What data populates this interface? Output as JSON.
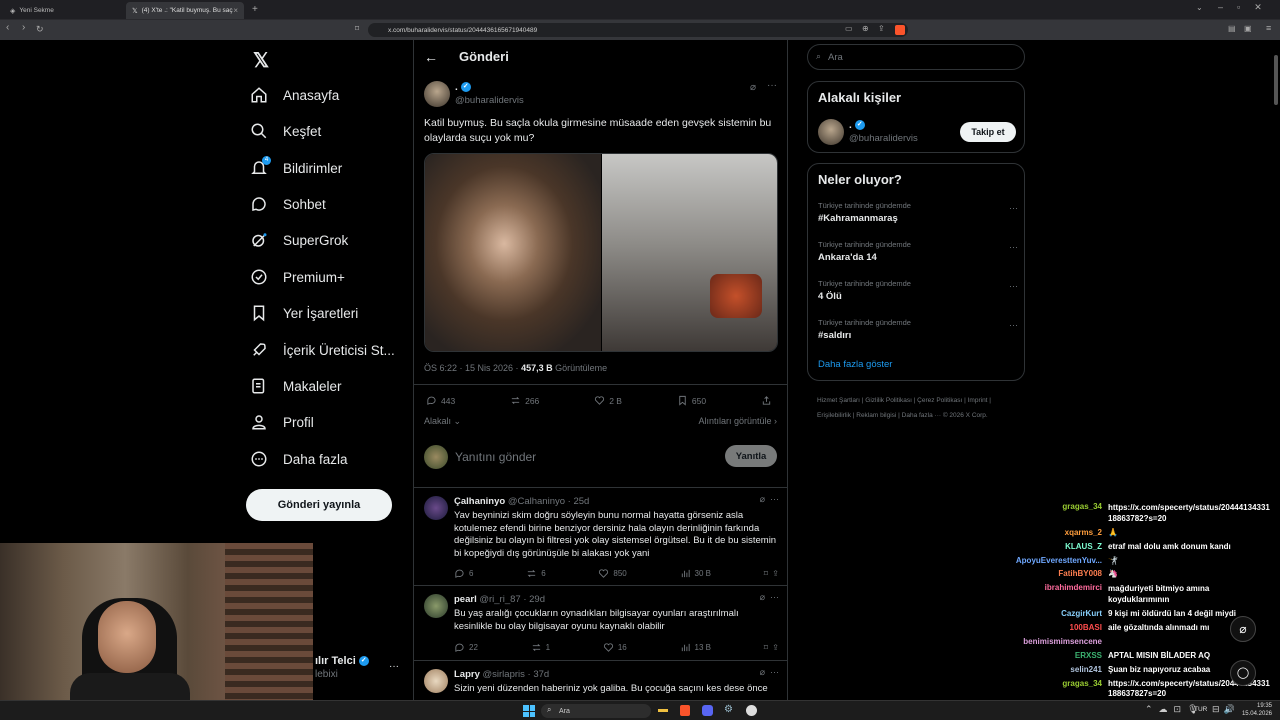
{
  "browser": {
    "tabs": [
      {
        "label": "Yeni Sekme"
      },
      {
        "label": "(4) X'te .: \"Katil buymuş. Bu saçla..."
      }
    ],
    "url": "x.com/buharalidervis/status/2044436165671940489"
  },
  "nav": {
    "items": [
      {
        "label": "Anasayfa",
        "icon": "home-icon"
      },
      {
        "label": "Keşfet",
        "icon": "search-icon"
      },
      {
        "label": "Bildirimler",
        "icon": "bell-icon",
        "badge": "4"
      },
      {
        "label": "Sohbet",
        "icon": "chat-icon"
      },
      {
        "label": "SuperGrok",
        "icon": "grok-icon"
      },
      {
        "label": "Premium+",
        "icon": "premium-icon"
      },
      {
        "label": "Yer İşaretleri",
        "icon": "bookmark-icon"
      },
      {
        "label": "İçerik Üreticisi St...",
        "icon": "rocket-icon"
      },
      {
        "label": "Makaleler",
        "icon": "article-icon"
      },
      {
        "label": "Profil",
        "icon": "profile-icon"
      },
      {
        "label": "Daha fazla",
        "icon": "more-icon"
      }
    ],
    "post_button": "Gönderi yayınla",
    "account_name": "ılır Telci",
    "account_handle": "lebixi"
  },
  "post": {
    "header_title": "Gönderi",
    "author_name": ".",
    "author_handle": "@buharalidervis",
    "text": "Katil buymuş. Bu saçla okula girmesine müsaade eden gevşek sistemin bu olaylarda suçu yok mu?",
    "time": "ÖS 6:22 · 15 Nis 2026 ·",
    "views": "457,3 B",
    "views_label": "Görüntüleme",
    "stats": {
      "replies": "443",
      "reposts": "266",
      "likes": "2 B",
      "bookmarks": "650"
    },
    "relevance_label": "Alakalı",
    "quotes_link": "Alıntıları görüntüle",
    "reply_placeholder": "Yanıtını gönder",
    "reply_button": "Yanıtla"
  },
  "replies": [
    {
      "name": "Çalhaninyo",
      "handle": "@Calhaninyo · 25d",
      "text": "Yav beyninizi skim doğru söyleyin bunu normal hayatta görseniz asla kotulemez efendi birine benziyor dersiniz hala olayın derinliğinin farkında değilsiniz bu olayın bi filtresi yok olay sistemsel örgütsel. Bu it de bu sistemin bi kopeğiydi dış görünüşüle bi alakası yok yani",
      "replies": "6",
      "reposts": "6",
      "likes": "850",
      "views": "30 B"
    },
    {
      "name": "pearl",
      "handle": "@ri_ri_87 · 29d",
      "text": "Bu yaş aralığı çocukların oynadıkları bilgisayar oyunları araştırılmalı kesinlikle bu olay bilgisayar oyunu kaynaklı olabilir",
      "replies": "22",
      "reposts": "1",
      "likes": "16",
      "views": "13 B"
    },
    {
      "name": "Lapry",
      "handle": "@sirlapris · 37d",
      "text": "Sizin yeni düzenden haberiniz yok galiba. Bu çocuğa saçını kes dese önce"
    }
  ],
  "sidebar": {
    "search_placeholder": "Ara",
    "people_title": "Alakalı kişiler",
    "person_name": ".",
    "person_handle": "@buharalidervis",
    "follow_button": "Takip et",
    "trends_title": "Neler oluyor?",
    "trends": [
      {
        "category": "Türkiye tarihinde gündemde",
        "name": "#Kahramanmaraş"
      },
      {
        "category": "Türkiye tarihinde gündemde",
        "name": "Ankara'da 14"
      },
      {
        "category": "Türkiye tarihinde gündemde",
        "name": "4 Ölü"
      },
      {
        "category": "Türkiye tarihinde gündemde",
        "name": "#saldırı"
      }
    ],
    "show_more": "Daha fazla göster",
    "footer": "Hizmet Şartları  |  Gizlilik Politikası  |  Çerez Politikası  |  Imprint  |  Erişilebilirlik  |  Reklam bilgisi  |  Daha fazla ··· © 2026 X Corp."
  },
  "chat": [
    {
      "user": "gragas_34",
      "msg": "https://x.com/specerty/status/2044413433118863782?s=20",
      "color": "#9acd32"
    },
    {
      "user": "xqarms_2",
      "msg": "🙏",
      "color": "#ff9e3d"
    },
    {
      "user": "KLAUS_Z",
      "msg": "etraf mal dolu amk donum kandı",
      "color": "#7fffd4"
    },
    {
      "user": "ApoyuEveresttenYuv...",
      "msg": "🤺",
      "color": "#6fa8ff"
    },
    {
      "user": "FatihBY008",
      "msg": "🦄",
      "color": "#ff7f50"
    },
    {
      "user": "ibrahimdemirci",
      "msg": "mağduriyeti bitmiyo amına koyduklarımının",
      "color": "#ff6b9d"
    },
    {
      "user": "CazgirKurt",
      "msg": "9 kişi mi öldürdü lan 4 değil miydi",
      "color": "#87cefa"
    },
    {
      "user": "100BASI",
      "msg": "aile gözaltında alınmadı mı",
      "color": "#ff4d4d"
    },
    {
      "user": "benimismimsencene",
      "msg": "",
      "color": "#dda0dd"
    },
    {
      "user": "ERXSS",
      "msg": "APTAL MISIN BİLADER AQ",
      "color": "#3cb371"
    },
    {
      "user": "selin241",
      "msg": "Şuan biz napıyoruz acabaa",
      "color": "#b0c4de"
    },
    {
      "user": "gragas_34",
      "msg": "https://x.com/specerty/status/20444134331188637827s=20",
      "color": "#9acd32"
    }
  ],
  "taskbar": {
    "search_label": "Ara",
    "lang": "TUR",
    "time": "19:35",
    "date": "15.04.2026"
  }
}
